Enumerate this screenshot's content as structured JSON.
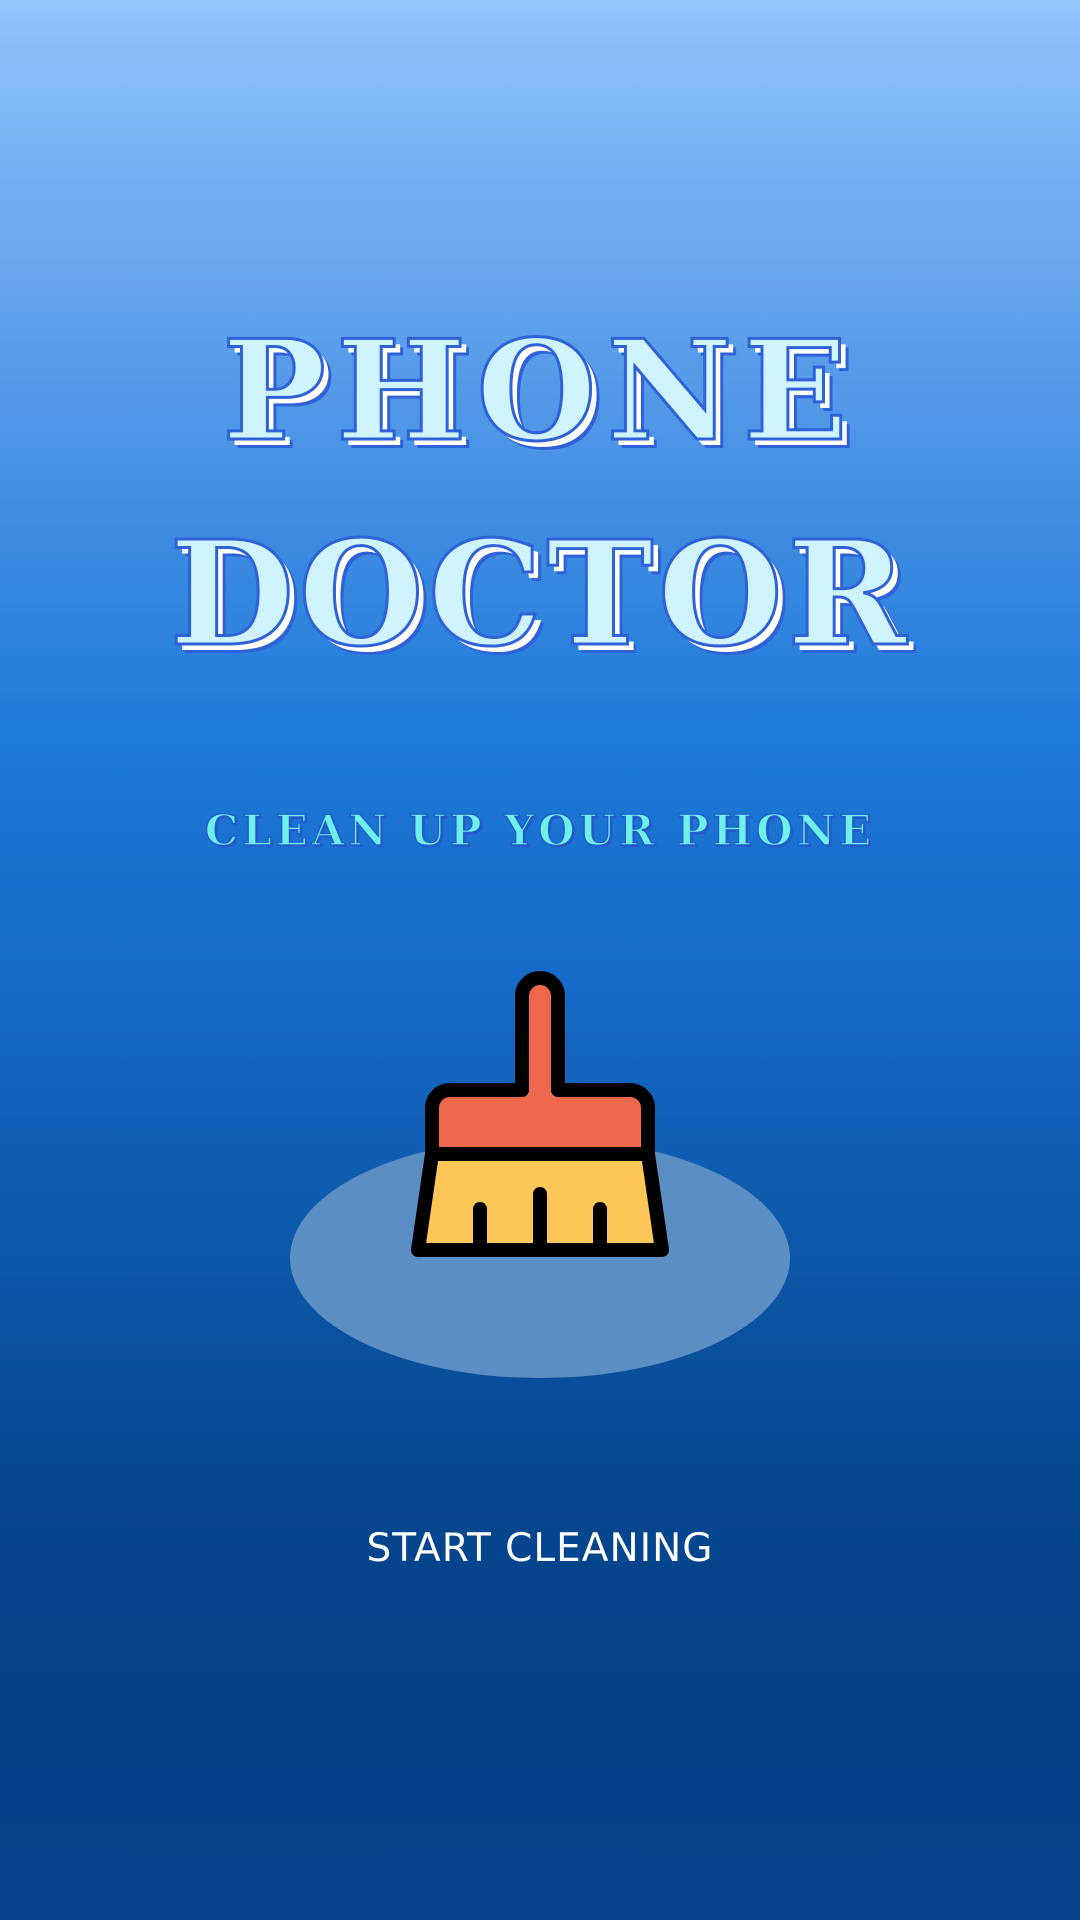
{
  "app": {
    "title_line_1": "PHONE",
    "title_line_2": "DOCTOR",
    "subtitle": "CLEAN UP YOUR PHONE",
    "start_button_label": "START CLEANING",
    "hero_icon": "broom-icon"
  },
  "colors": {
    "title_fill": "#cff3ff",
    "title_outline": "#2f62d9",
    "subtitle_fill": "#6ff0e8",
    "broom_handle": "#ef674c",
    "broom_bristles": "#ffc75a",
    "icon_backdrop": "#5b8ec2",
    "background_top": "#91c6ff",
    "background_bottom": "#03418a"
  }
}
